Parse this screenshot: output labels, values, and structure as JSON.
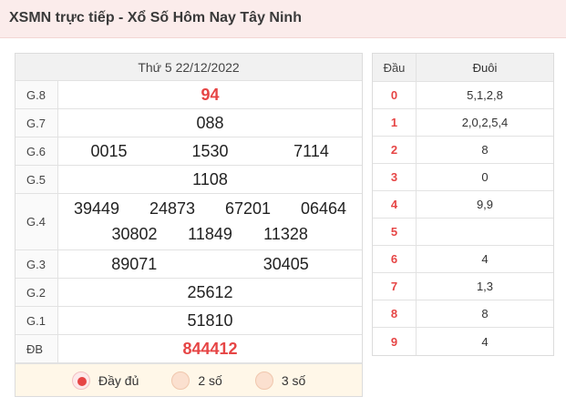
{
  "header": {
    "title": "XSMN trực tiếp - Xổ Số Hôm Nay Tây Ninh"
  },
  "results": {
    "date": "Thứ 5 22/12/2022",
    "prizes": [
      {
        "label": "G.8",
        "numbers": [
          "94"
        ]
      },
      {
        "label": "G.7",
        "numbers": [
          "088"
        ]
      },
      {
        "label": "G.6",
        "numbers": [
          "0015",
          "1530",
          "7114"
        ]
      },
      {
        "label": "G.5",
        "numbers": [
          "1108"
        ]
      },
      {
        "label": "G.4",
        "numbers": [
          "39449",
          "24873",
          "67201",
          "06464",
          "30802",
          "11849",
          "11328"
        ]
      },
      {
        "label": "G.3",
        "numbers": [
          "89071",
          "30405"
        ]
      },
      {
        "label": "G.2",
        "numbers": [
          "25612"
        ]
      },
      {
        "label": "G.1",
        "numbers": [
          "51810"
        ]
      },
      {
        "label": "ĐB",
        "numbers": [
          "844412"
        ]
      }
    ],
    "display_options": [
      "Đầy đủ",
      "2 số",
      "3 số"
    ],
    "selected_option": "Đầy đủ"
  },
  "loto": {
    "head_label": "Đầu",
    "tail_label": "Đuôi",
    "rows": [
      {
        "dau": "0",
        "duoi": "5,1,2,8"
      },
      {
        "dau": "1",
        "duoi": "2,0,2,5,4"
      },
      {
        "dau": "2",
        "duoi": "8"
      },
      {
        "dau": "3",
        "duoi": "0"
      },
      {
        "dau": "4",
        "duoi": "9,9"
      },
      {
        "dau": "5",
        "duoi": ""
      },
      {
        "dau": "6",
        "duoi": "4"
      },
      {
        "dau": "7",
        "duoi": "1,3"
      },
      {
        "dau": "8",
        "duoi": "8"
      },
      {
        "dau": "9",
        "duoi": "4"
      }
    ]
  },
  "colors": {
    "accent": "#e64545",
    "header_bg": "#fbeceb",
    "options_bg": "#fff7e8"
  }
}
